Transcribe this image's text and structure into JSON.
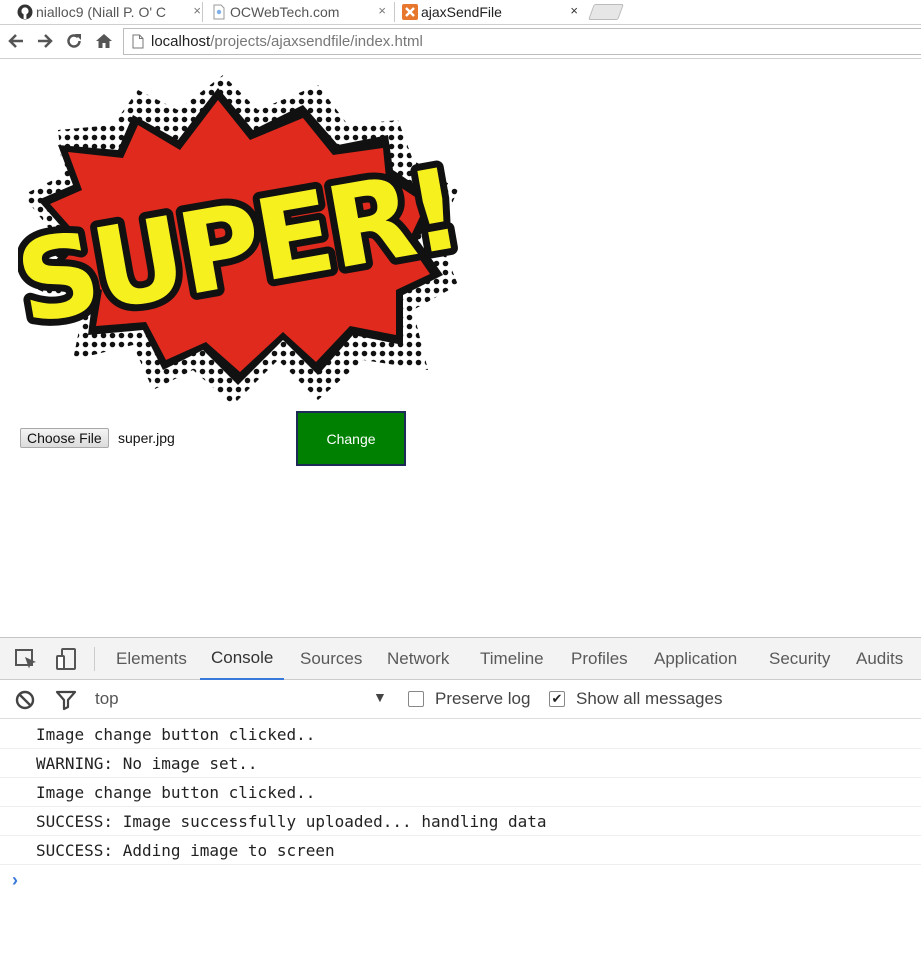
{
  "browser": {
    "tabs": [
      {
        "label": "nialloc9 (Niall P. O' C",
        "icon": "github-icon",
        "close": "×"
      },
      {
        "label": "OCWebTech.com",
        "icon": "page-icon",
        "close": "×"
      },
      {
        "label": "ajaxSendFile",
        "icon": "xampp-icon",
        "close": "×"
      }
    ],
    "url": {
      "host": "localhost",
      "path": "/projects/ajaxsendfile/index.html"
    }
  },
  "page": {
    "image_alt": "SUPER!",
    "image_text": "SUPER!",
    "file_input": {
      "button_label": "Choose File",
      "file_name": "super.jpg"
    },
    "change_button": "Change",
    "colors": {
      "change_bg": "#008000",
      "change_border": "#1c2c57"
    }
  },
  "devtools": {
    "tabs": [
      "Elements",
      "Console",
      "Sources",
      "Network",
      "Timeline",
      "Profiles",
      "Application",
      "Security",
      "Audits"
    ],
    "active_tab": "Console",
    "context": "top",
    "context_arrow": "▼",
    "preserve_log": {
      "label": "Preserve log",
      "checked": false
    },
    "show_all": {
      "label": "Show all messages",
      "checked": true,
      "mark": "✔"
    },
    "console_lines": [
      "Image change button clicked..",
      "WARNING: No image set..",
      "Image change button clicked..",
      "SUCCESS: Image successfully uploaded... handling data",
      "SUCCESS: Adding image to screen"
    ],
    "prompt": "›"
  }
}
